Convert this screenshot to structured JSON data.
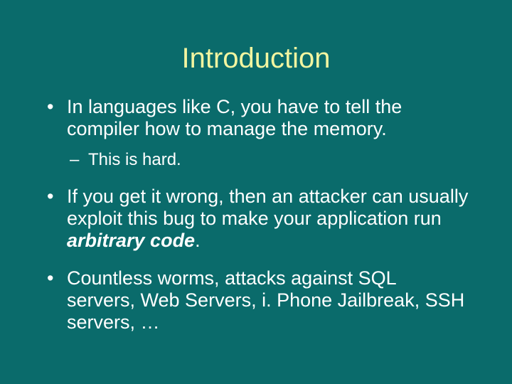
{
  "title": "Introduction",
  "bullets": {
    "b1": "In languages like C, you have to tell the compiler how to manage the memory.",
    "b1_sub1": "This is hard.",
    "b2_pre": "If you get it wrong, then an attacker can usually exploit this bug to make your application run ",
    "b2_emph": "arbitrary code",
    "b2_post": ".",
    "b3": "Countless worms, attacks against SQL servers, Web Servers, i. Phone Jailbreak, SSH servers, …"
  }
}
